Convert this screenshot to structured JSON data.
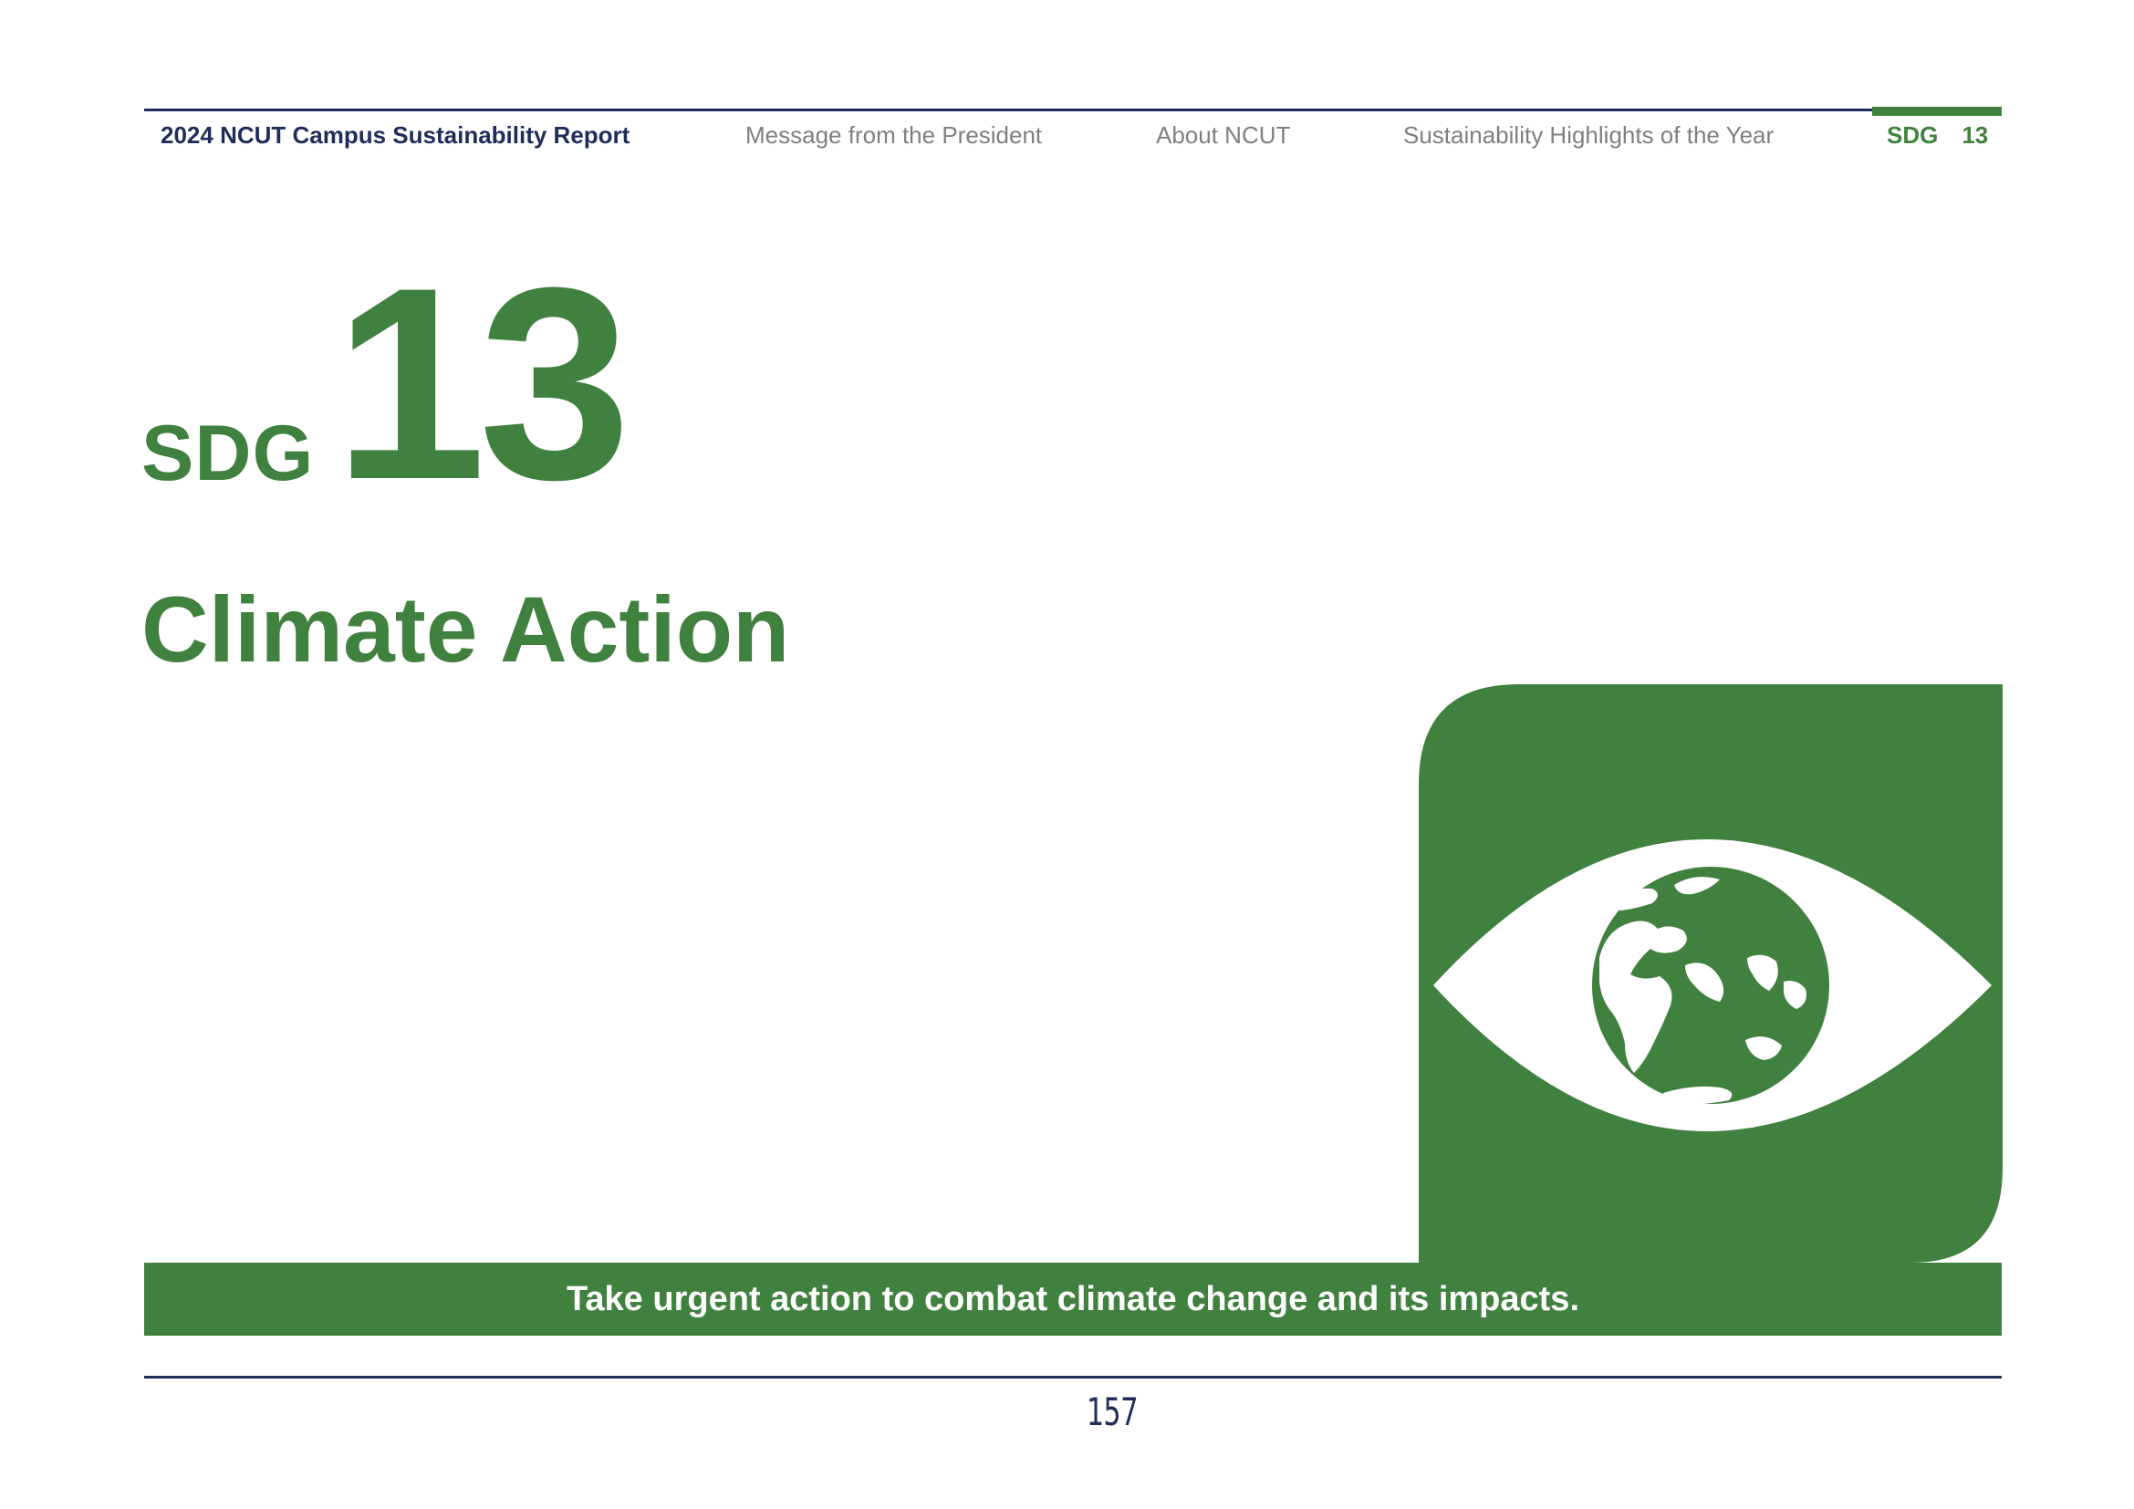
{
  "header": {
    "report_title": "2024 NCUT Campus Sustainability Report",
    "nav": [
      "Message from the President",
      "About NCUT",
      "Sustainability Highlights of the Year"
    ],
    "current_section_prefix": "SDG",
    "current_section_number": "13"
  },
  "title": {
    "prefix": "SDG",
    "number": "13",
    "goal": "Climate Action"
  },
  "icon": {
    "name": "eye-with-globe-icon"
  },
  "tagline": "Take urgent action to combat climate change and its impacts.",
  "footer": {
    "page_number": "157"
  },
  "colors": {
    "brand_green": "#41813f",
    "navy": "#1f2d5a",
    "nav_gray": "#7f7f7f"
  }
}
